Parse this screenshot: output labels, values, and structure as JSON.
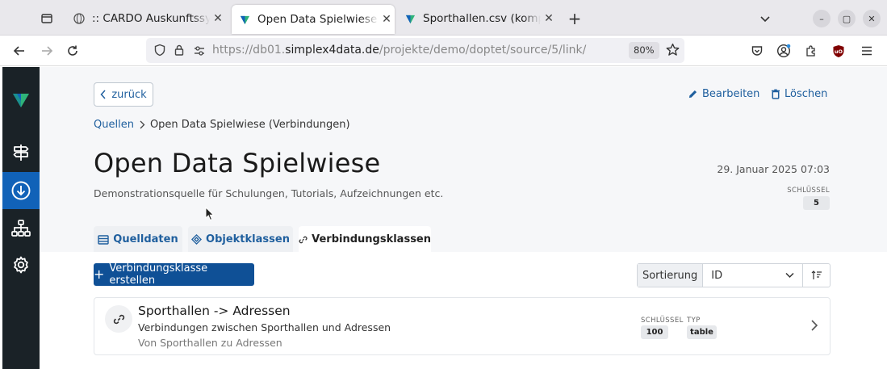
{
  "browser": {
    "tabs": [
      {
        "title": ":: CARDO Auskunftssystem",
        "active": false
      },
      {
        "title": "Open Data Spielwiese - Verbindungen",
        "active": true
      },
      {
        "title": "Sporthallen.csv (komplett)",
        "active": false
      }
    ],
    "url_prefix": "https://db01.",
    "url_domain": "simplex4data.de",
    "url_path": "/projekte/demo/doptet/source/5/link/",
    "zoom": "80%"
  },
  "colors": {
    "accent": "#0f5096",
    "sidebar": "#1a2227",
    "sidebar_active": "#1162b8",
    "logo_green": "#2fb37a"
  },
  "sidebar": {
    "items": [
      {
        "icon": "signpost-icon"
      },
      {
        "icon": "download-circle-icon",
        "active": true
      },
      {
        "icon": "sitemap-icon"
      },
      {
        "icon": "gear-icon"
      }
    ]
  },
  "page": {
    "back_label": "zurück",
    "edit_label": "Bearbeiten",
    "delete_label": "Löschen",
    "breadcrumb_root": "Quellen",
    "breadcrumb_current": "Open Data Spielwiese (Verbindungen)",
    "title": "Open Data Spielwiese",
    "description": "Demonstrationsquelle für Schulungen, Tutorials, Aufzeichnungen etc.",
    "date": "29. Januar 2025 07:03",
    "key_label": "SCHLÜSSEL",
    "key_value": "5"
  },
  "tabs": [
    {
      "label": "Quelldaten",
      "icon": "table-icon"
    },
    {
      "label": "Objektklassen",
      "icon": "diamond-icon"
    },
    {
      "label": "Verbindungsklassen",
      "icon": "link-icon",
      "active": true
    }
  ],
  "toolbar": {
    "create_label": "Verbindungsklasse erstellen",
    "sort_label": "Sortierung",
    "sort_value": "ID"
  },
  "items": [
    {
      "title": "Sporthallen -> Adressen",
      "subtitle": "Verbindungen zwischen Sporthallen und Adressen",
      "note": "Von Sporthallen zu Adressen",
      "key_label": "SCHLÜSSEL",
      "key_value": "100",
      "type_label": "TYP",
      "type_value": "table"
    }
  ]
}
